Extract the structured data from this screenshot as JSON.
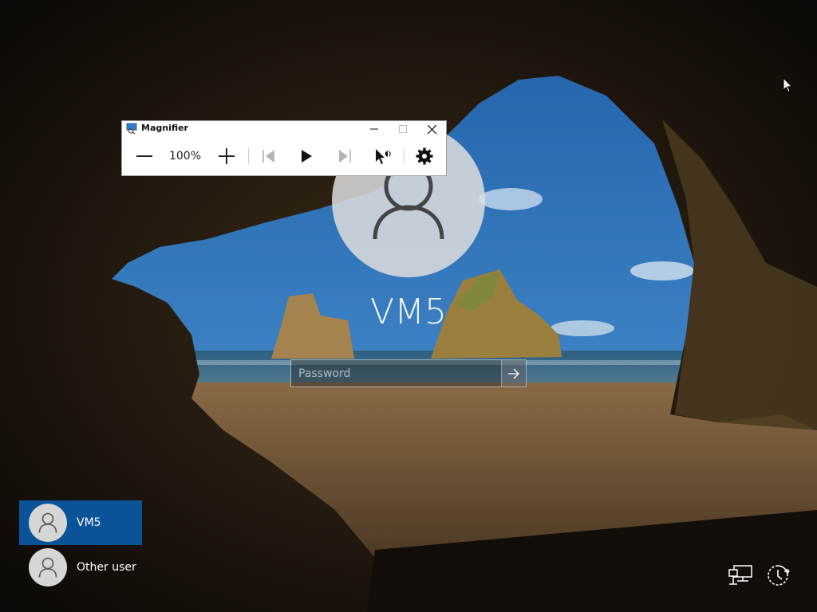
{
  "background": {
    "sky": "#2d6fb6",
    "sand": "#7a5a3c",
    "rock": "#3b2c1b"
  },
  "login": {
    "username": "VM5",
    "password_placeholder": "Password",
    "submit_icon": "arrow-right-icon"
  },
  "users": [
    {
      "label": "VM5",
      "active": true
    },
    {
      "label": "Other user",
      "active": false
    }
  ],
  "magnifier": {
    "title": "Magnifier",
    "zoom": "100%",
    "buttons": [
      "zoom-out",
      "zoom-in",
      "previous",
      "play",
      "next",
      "read-from-here",
      "settings"
    ]
  },
  "corner_icons": [
    "network-icon",
    "ease-of-access-icon"
  ],
  "colors": {
    "accent": "#0a5398",
    "avatar_bg": "#d6d6d6"
  }
}
